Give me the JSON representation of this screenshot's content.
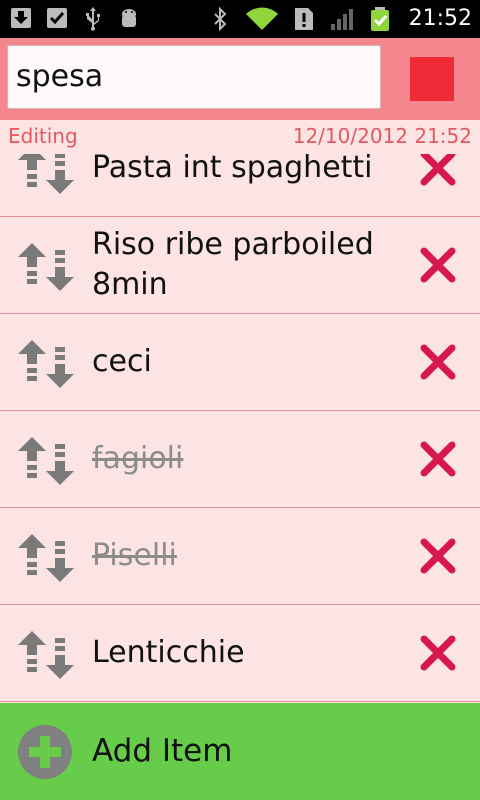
{
  "status_bar": {
    "time": "21:52",
    "left_icons": [
      "download-icon",
      "clipboard-check-icon",
      "usb-icon",
      "android-debug-icon"
    ],
    "right_icons": [
      "bluetooth-icon",
      "wifi-icon",
      "alert-icon",
      "cell-signal-icon",
      "battery-charging-icon"
    ]
  },
  "header": {
    "search_value": "spesa",
    "stop_color": "#ee2b36"
  },
  "edit_bar": {
    "label": "Editing",
    "timestamp": "12/10/2012 21:52"
  },
  "items": [
    {
      "label": "Pasta int spaghetti",
      "done": false
    },
    {
      "label": "Riso ribe parboiled 8min",
      "done": false
    },
    {
      "label": "ceci",
      "done": false
    },
    {
      "label": "fagioli",
      "done": true
    },
    {
      "label": "Piselli",
      "done": true
    },
    {
      "label": "Lenticchie",
      "done": false
    }
  ],
  "add_bar": {
    "label": "Add Item"
  },
  "colors": {
    "header_bg": "#f4878e",
    "list_bg": "#fce4e4",
    "divider": "#e98f93",
    "delete": "#d6184c",
    "add_bg": "#66cc4a"
  }
}
